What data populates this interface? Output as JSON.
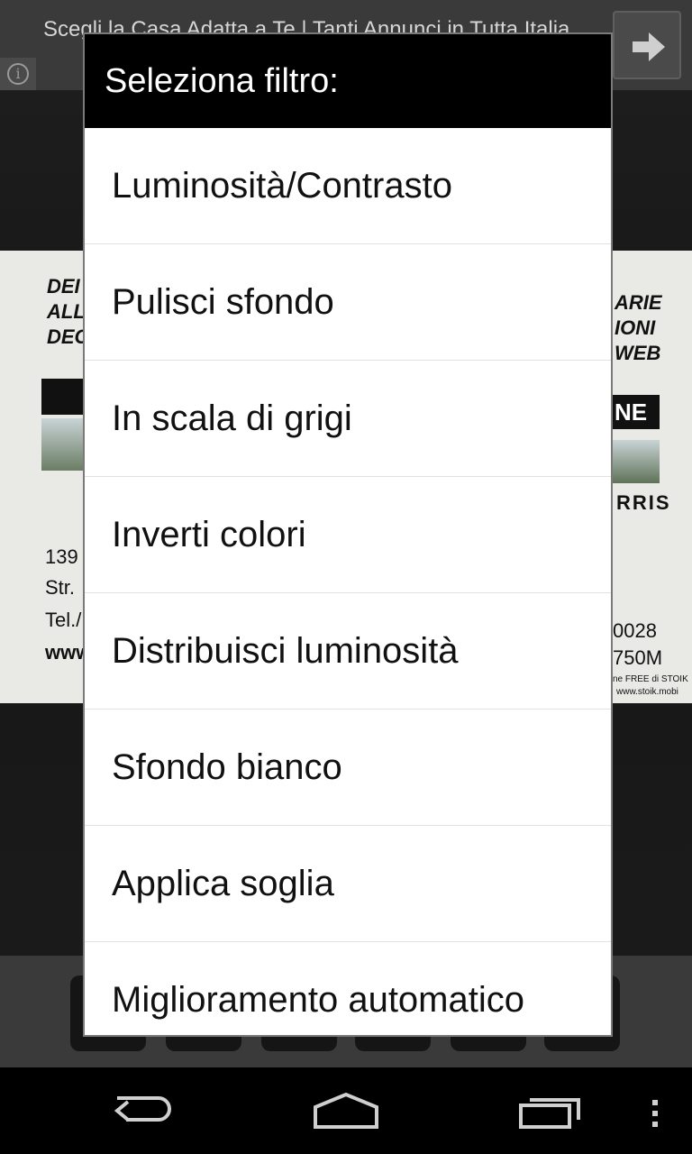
{
  "ad": {
    "text": "Scegli la Casa Adatta a Te | Tanti Annunci in Tutta Italia.",
    "info_icon_glyph": "i",
    "arrow_icon": "arrow-right-icon"
  },
  "background_document": {
    "left_lines": [
      "DEI",
      "ALL",
      "DEC"
    ],
    "left_bottom_lines": [
      "139",
      "Str.",
      "Tel./",
      "www"
    ],
    "right_lines": [
      "ARIE",
      "IONI",
      "WEB"
    ],
    "right_block": "NE",
    "right_mid": "RRIS",
    "right_bottom_lines": [
      "0028",
      "750M"
    ],
    "right_footer_lines": [
      "ne FREE di STOIK",
      "www.stoik.mobi"
    ]
  },
  "dialog": {
    "title": "Seleziona filtro:",
    "items": [
      {
        "label": "Luminosità/Contrasto"
      },
      {
        "label": "Pulisci sfondo"
      },
      {
        "label": "In scala di grigi"
      },
      {
        "label": "Inverti colori"
      },
      {
        "label": "Distribuisci luminosità"
      },
      {
        "label": "Sfondo bianco"
      },
      {
        "label": "Applica soglia"
      },
      {
        "label": "Miglioramento automatico"
      }
    ]
  },
  "nav_bar": {
    "back_icon": "back-icon",
    "home_icon": "home-icon",
    "recents_icon": "recent-apps-icon",
    "menu_icon": "overflow-menu-icon"
  },
  "colors": {
    "dialog_title_bg": "#000000",
    "dialog_bg": "#ffffff",
    "divider": "#e2e2e2"
  }
}
